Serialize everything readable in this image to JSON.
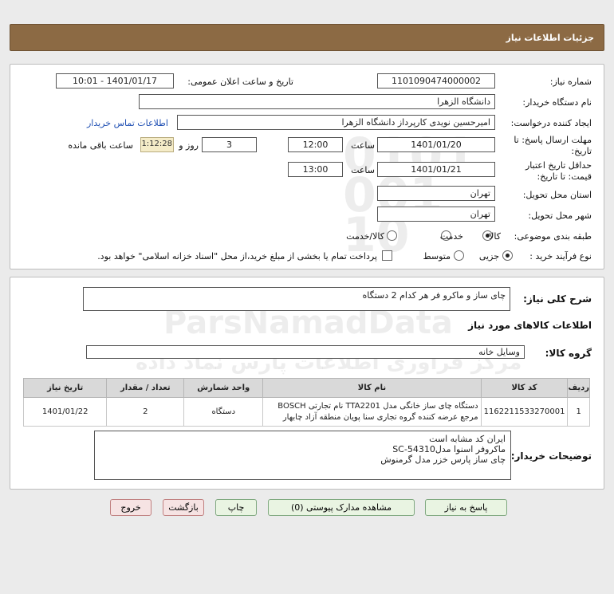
{
  "header": {
    "title": "جزئیات اطلاعات نیاز"
  },
  "form": {
    "need_number_label": "شماره نیاز:",
    "need_number": "1101090474000002",
    "announce_label": "تاریخ و ساعت اعلان عمومی:",
    "announce_value": "1401/01/17 - 10:01",
    "buyer_org_label": "نام دستگاه خریدار:",
    "buyer_org": "دانشگاه الزهرا",
    "creator_label": "ایجاد کننده درخواست:",
    "creator": "امیرحسین نویدی کارپرداز دانشگاه الزهرا",
    "contact_link": "اطلاعات تماس خریدار",
    "deadline_label_1": "مهلت ارسال پاسخ: تا",
    "deadline_label_2": "تاریخ:",
    "deadline_date": "1401/01/20",
    "time_label": "ساعت",
    "deadline_time": "12:00",
    "days_value": "3",
    "days_label": "روز و",
    "timer": "01:12:28",
    "remaining_label": "ساعت باقی مانده",
    "validity_label_1": "حداقل تاریخ اعتبار",
    "validity_label_2": "قیمت: تا تاریخ:",
    "validity_date": "1401/01/21",
    "validity_time_label": "ساعت",
    "validity_time": "13:00",
    "province_label": "استان محل تحویل:",
    "province": "تهران",
    "city_label": "شهر محل تحویل:",
    "city": "تهران",
    "category_label": "طبقه بندی موضوعی:",
    "category_options": [
      "کالا",
      "خدمت",
      "کالا/خدمت"
    ],
    "process_label": "نوع فرآیند خرید :",
    "process_options": [
      "جزیی",
      "متوسط"
    ],
    "payment_note": "پرداخت تمام یا بخشی از مبلغ خرید،از محل \"اسناد خزانه اسلامی\" خواهد بود."
  },
  "summary": {
    "label": "شرح کلی نیاز:",
    "value": "چای ساز  و ماکرو فر هر کدام 2 دستگاه"
  },
  "goods": {
    "section_title": "اطلاعات کالاهای مورد نیاز",
    "group_label": "گروه کالا:",
    "group_value": "وسایل خانه",
    "columns": [
      "ردیف",
      "کد کالا",
      "نام کالا",
      "واحد شمارش",
      "تعداد / مقدار",
      "تاریخ نیاز"
    ],
    "rows": [
      {
        "index": "1",
        "code": "1162211533270001",
        "name_line1": "دستگاه چای ساز خانگی مدل TTA2201 نام تجارتی BOSCH",
        "name_line2": "مرجع عرضه کننده گروه تجاری سنا پویان منطقه آزاد چابهار",
        "unit": "دستگاه",
        "qty": "2",
        "date": "1401/01/22"
      }
    ]
  },
  "buyer_notes": {
    "label": "توضیحات خریدار:",
    "lines": [
      "ایران کد مشابه است",
      "ماکروفر اسنوا مدلSC-54310",
      "چای ساز پارس خزر مدل گرمنوش"
    ]
  },
  "buttons": {
    "reply": "پاسخ به نیاز",
    "attachments": "مشاهده مدارک پیوستی (0)",
    "print": "چاپ",
    "back": "بازگشت",
    "exit": "خروج"
  }
}
